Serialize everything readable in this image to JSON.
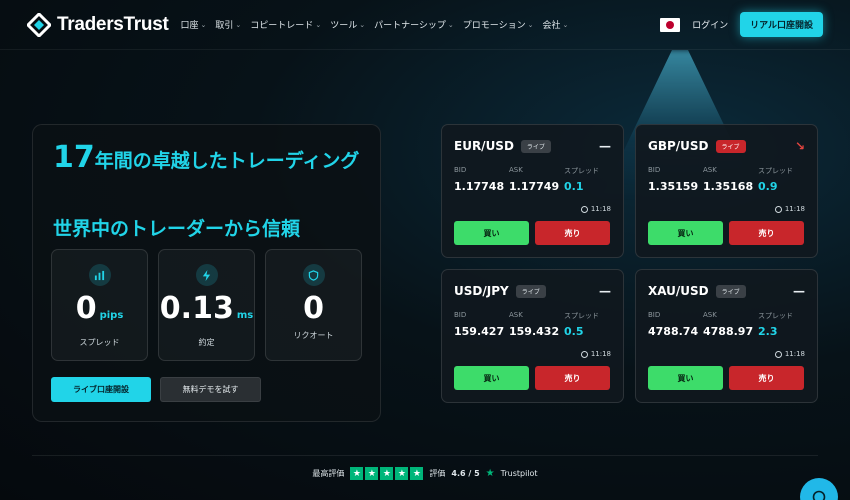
{
  "brand": {
    "name": "TradersTrust"
  },
  "nav": [
    {
      "label": "口座"
    },
    {
      "label": "取引"
    },
    {
      "label": "コピートレード"
    },
    {
      "label": "ツール"
    },
    {
      "label": "パートナーシップ"
    },
    {
      "label": "プロモーション"
    },
    {
      "label": "会社"
    }
  ],
  "header": {
    "login": "ログイン",
    "open_real": "リアル口座開設",
    "flag": "japan-flag"
  },
  "hero": {
    "title_number": "17",
    "title_rest": "年間の卓越したトレーディング",
    "subtitle": "世界中のトレーダーから信頼",
    "stats": [
      {
        "icon": "chart-icon",
        "value": "0",
        "unit": "pips",
        "label": "スプレッド"
      },
      {
        "icon": "lightning-icon",
        "value": "0.13",
        "unit": "ms",
        "label": "約定"
      },
      {
        "icon": "shield-icon",
        "value": "0",
        "unit": "",
        "label": "リクオート"
      }
    ],
    "btn_live": "ライブ口座開設",
    "btn_demo": "無料デモを試す"
  },
  "quote_labels": {
    "bid": "BID",
    "ask": "ASK",
    "spread": "スプレッド",
    "buy": "買い",
    "sell": "売り"
  },
  "quotes": [
    {
      "pair": "EUR/USD",
      "badge": "ライブ",
      "trend": "—",
      "bid": "1.17748",
      "ask": "1.17749",
      "spread": "0.1",
      "time": "11:18"
    },
    {
      "pair": "GBP/USD",
      "badge": "ライブ",
      "trend": "↘",
      "bid": "1.35159",
      "ask": "1.35168",
      "spread": "0.9",
      "time": "11:18"
    },
    {
      "pair": "USD/JPY",
      "badge": "ライブ",
      "trend": "—",
      "bid": "159.427",
      "ask": "159.432",
      "spread": "0.5",
      "time": "11:18"
    },
    {
      "pair": "XAU/USD",
      "badge": "ライブ",
      "trend": "—",
      "bid": "4788.74",
      "ask": "4788.97",
      "spread": "2.3",
      "time": "11:18"
    }
  ],
  "rating": {
    "prefix": "最高評価",
    "label": "評価",
    "score": "4.6 / 5",
    "provider": "Trustpilot",
    "stars": 5
  },
  "colors": {
    "accent": "#21d4e8",
    "buy": "#3ddc6a",
    "sell": "#c8262b",
    "trustpilot": "#00b67a"
  }
}
